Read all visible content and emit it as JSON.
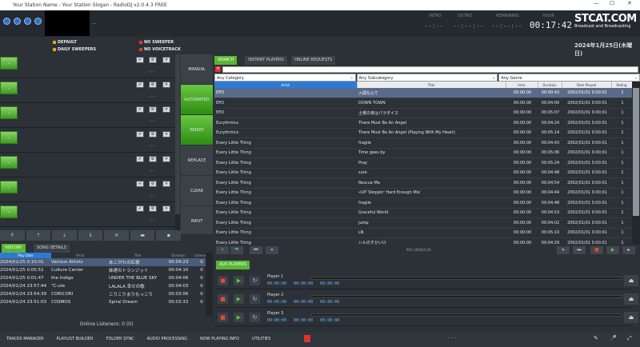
{
  "window": {
    "title": "Your Station Name - Your Station Slogan - RadioDJ v2.0.4.3 FREE"
  },
  "header": {
    "preview_dash": "--",
    "intro_label": "INTRO",
    "intro_val": "--:--",
    "outro_label": "OUTRO",
    "outro_val": "--:--:--",
    "remaining_label": "REMAINING",
    "remaining_val": "--:--:--",
    "hour_label": "HOUR",
    "hour_val": "00:17:42",
    "logo_big": "STCAT.COM",
    "logo_small": "Broadcast and Broadcasting"
  },
  "sweepers": {
    "default": "DEFAULT",
    "daily": "DAILY SWEEPERS",
    "no_sweeper": "NO SWEEPER",
    "no_voicetrack": "NO VOICETRACK",
    "date": "2024年1月25日(木曜日)"
  },
  "carts": [
    {
      "play": "-",
      "dim": "--:--"
    },
    {
      "play": "-",
      "dim": "--:--"
    },
    {
      "play": "-",
      "dim": "--:--"
    },
    {
      "play": "-",
      "dim": "--:--"
    },
    {
      "play": "-",
      "dim": "--:--"
    },
    {
      "play": "-",
      "dim": "--:--"
    },
    {
      "play": "-",
      "dim": "--:--"
    }
  ],
  "modes": [
    "MANUAL",
    "AUTOMATED",
    "INSERT",
    "REPLACE",
    "CLEAR",
    "INPUT"
  ],
  "cart_toolbar": [
    "⇑",
    "⇡",
    "⇣",
    "⇓",
    "✕",
    "▬",
    "▪"
  ],
  "right_tabs": {
    "search": "SEARCH",
    "instant": "INSTANT PLAYERS",
    "online": "ONLINE REQUESTS"
  },
  "filters": [
    "Any Category",
    "Any Subcategory",
    "Any Genre"
  ],
  "library": {
    "headers": [
      "Artist",
      "Title",
      "Intro",
      "Duration",
      "Date Played",
      "Rating"
    ],
    "rows": [
      [
        "EPO",
        "入間なんて",
        "00:00:00",
        "00:00:43",
        "2002/01/01 0:00:01",
        "1"
      ],
      [
        "EPO",
        "DOWN TOWN",
        "00:00:00",
        "00:04:00",
        "2002/01/01 0:00:01",
        "1"
      ],
      [
        "EPO",
        "土曜の夜はパラダイス",
        "00:00:00",
        "00:05:07",
        "2002/01/01 0:00:01",
        "1"
      ],
      [
        "Eurythmics",
        "There Must Be An Angel",
        "00:00:00",
        "00:04:24",
        "2002/01/01 0:00:01",
        "1"
      ],
      [
        "Eurythmics",
        "There Must Be An Angel (Playing With My Heart)",
        "00:00:00",
        "00:05:14",
        "2002/01/01 0:00:01",
        "1"
      ],
      [
        "Every Little Thing",
        "fragile",
        "00:00:00",
        "00:04:43",
        "2002/01/01 0:00:01",
        "1"
      ],
      [
        "Every Little Thing",
        "Time goes by",
        "00:00:00",
        "00:05:06",
        "2002/01/01 0:00:01",
        "1"
      ],
      [
        "Every Little Thing",
        "Pray",
        "00:00:00",
        "00:05:24",
        "2002/01/01 0:00:01",
        "1"
      ],
      [
        "Every Little Thing",
        "sure",
        "00:00:00",
        "00:04:48",
        "2002/01/01 0:00:01",
        "1"
      ],
      [
        "Every Little Thing",
        "Rescue Me",
        "00:00:00",
        "00:04:54",
        "2002/01/01 0:00:01",
        "1"
      ],
      [
        "Every Little Thing",
        "«UP`Steppin' Hard Enough Mix`",
        "00:00:00",
        "00:04:44",
        "2002/01/01 0:00:01",
        "1"
      ],
      [
        "Every Little Thing",
        "fragile",
        "00:00:00",
        "00:04:48",
        "2002/01/01 0:00:01",
        "1"
      ],
      [
        "Every Little Thing",
        "Graceful World",
        "00:00:00",
        "00:04:53",
        "2002/01/01 0:00:01",
        "1"
      ],
      [
        "Every Little Thing",
        "jump",
        "00:00:00",
        "00:04:02",
        "2002/01/01 0:00:01",
        "1"
      ],
      [
        "Every Little Thing",
        "LN",
        "00:00:00",
        "00:05:10",
        "2002/01/01 0:00:01",
        "1"
      ],
      [
        "Every Little Thing",
        "ハルのすかいけ",
        "00:00:00",
        "00:04:29",
        "2002/01/01 0:00:01",
        "1"
      ]
    ],
    "range": "901-1000/2126"
  },
  "history": {
    "tab_history": "HISTORY",
    "tab_song": "SONG DETAILS",
    "headers": [
      "Play Date",
      "Artist",
      "Title",
      "Duration",
      "Listeners"
    ],
    "rows": [
      [
        "2024/01/25 0:10:01",
        "Various Artists",
        "あこがれの紅様",
        "00:04:23",
        "0"
      ],
      [
        "2024/01/25 0:05:51",
        "Culture Center",
        "妹達のトランジット",
        "00:04:10",
        "0"
      ],
      [
        "2024/01/25 0:01:47",
        "the Indigo",
        "UNDER THE BLUE SKY",
        "00:04:06",
        "0"
      ],
      [
        "2024/01/24 23:57:44",
        "℃-ute",
        "LALALA 幸せの歌",
        "00:04:03",
        "0"
      ],
      [
        "2024/01/24 23:54:39",
        "CORICORI",
        "こりこりまりもっこり",
        "00:03:06",
        "0"
      ],
      [
        "2024/01/24 23:51:03",
        "COSMOS",
        "Spiral Dream",
        "00:03:33",
        "0"
      ]
    ],
    "listeners": "Online Listeners: 0 (0)"
  },
  "players": {
    "tab": "AUX PLAYERS",
    "list": [
      {
        "name": "Player 1",
        "times": "00:00:00 00:00:00 00:00:00"
      },
      {
        "name": "Player 2",
        "times": "00:00:00 00:00:00 00:00:00"
      },
      {
        "name": "Player 3",
        "times": "00:00:00 00:00:00 00:00:00"
      }
    ]
  },
  "bottom_nav": [
    "TRACKS MANAGER",
    "PLAYLIST BUILDER",
    "FOLDER SYNC",
    "AUDIO PROCESSING",
    "NOW PLAYING INFO",
    "UTILITIES"
  ],
  "bottom_dash": "- - -"
}
